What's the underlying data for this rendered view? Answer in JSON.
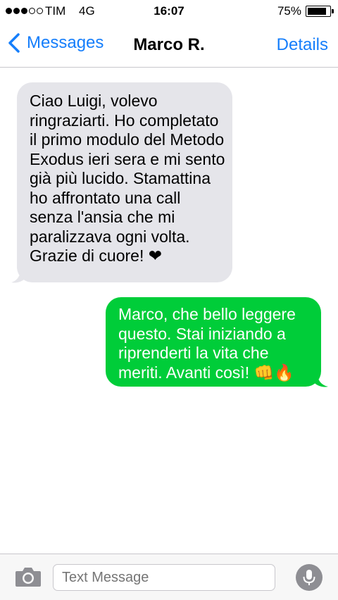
{
  "status_bar": {
    "carrier": "TIM",
    "network": "4G",
    "time": "16:07",
    "battery_text": "75%",
    "battery_level": 0.75,
    "signal_bars_filled": 3,
    "signal_bars_total": 5
  },
  "nav": {
    "back_label": "Messages",
    "title": "Marco R.",
    "details_label": "Details"
  },
  "messages": [
    {
      "direction": "received",
      "text": "Ciao Luigi, volevo ringraziarti. Ho completato il primo modulo del Metodo Exodus ieri sera e mi sento già più lucido. Stamattina ho affrontato una call senza l'ansia che mi paralizzava ogni volta. Grazie di cuore! ❤"
    },
    {
      "direction": "sent",
      "text": "Marco, che bello leggere questo. Stai iniziando a riprenderti la vita che meriti. Avanti così! 👊🔥"
    }
  ],
  "input": {
    "placeholder": "Text Message",
    "camera_icon": "camera-icon",
    "mic_icon": "microphone-icon"
  },
  "colors": {
    "accent": "#157efb",
    "received_bubble": "#e5e5ea",
    "sent_bubble": "#00cd39"
  }
}
